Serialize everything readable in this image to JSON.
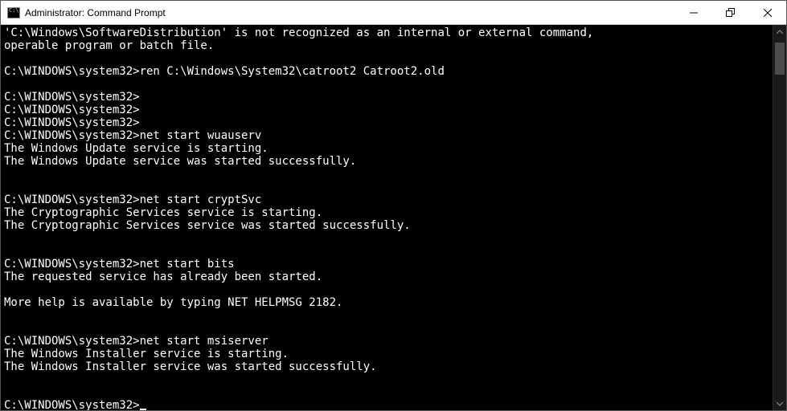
{
  "title": "Administrator: Command Prompt",
  "prompt": "C:\\WINDOWS\\system32>",
  "lines": [
    "'C:\\Windows\\SoftwareDistribution' is not recognized as an internal or external command,",
    "operable program or batch file.",
    "",
    "C:\\WINDOWS\\system32>ren C:\\Windows\\System32\\catroot2 Catroot2.old",
    "",
    "C:\\WINDOWS\\system32>",
    "C:\\WINDOWS\\system32>",
    "C:\\WINDOWS\\system32>",
    "C:\\WINDOWS\\system32>net start wuauserv",
    "The Windows Update service is starting.",
    "The Windows Update service was started successfully.",
    "",
    "",
    "C:\\WINDOWS\\system32>net start cryptSvc",
    "The Cryptographic Services service is starting.",
    "The Cryptographic Services service was started successfully.",
    "",
    "",
    "C:\\WINDOWS\\system32>net start bits",
    "The requested service has already been started.",
    "",
    "More help is available by typing NET HELPMSG 2182.",
    "",
    "",
    "C:\\WINDOWS\\system32>net start msiserver",
    "The Windows Installer service is starting.",
    "The Windows Installer service was started successfully.",
    "",
    ""
  ]
}
